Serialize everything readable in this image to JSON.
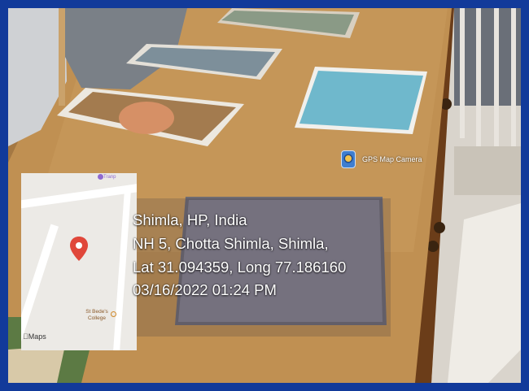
{
  "location": {
    "title": "Shimla, HP, India",
    "address": "NH 5, Chotta Shimla, Shimla,",
    "coordinates": "Lat 31.094359, Long 77.186160",
    "datetime": "03/16/2022 01:24 PM"
  },
  "badge": {
    "label": "GPS Map Camera",
    "icon": "gps-map-camera-icon"
  },
  "map": {
    "poi_top": "Tranp",
    "poi_bottom": "St Bede's College",
    "attribution": "Maps",
    "pin_icon": "map-pin-icon",
    "pin_color": "#e0473a"
  },
  "colors": {
    "frame": "#123a9a",
    "table": "#b88846"
  }
}
